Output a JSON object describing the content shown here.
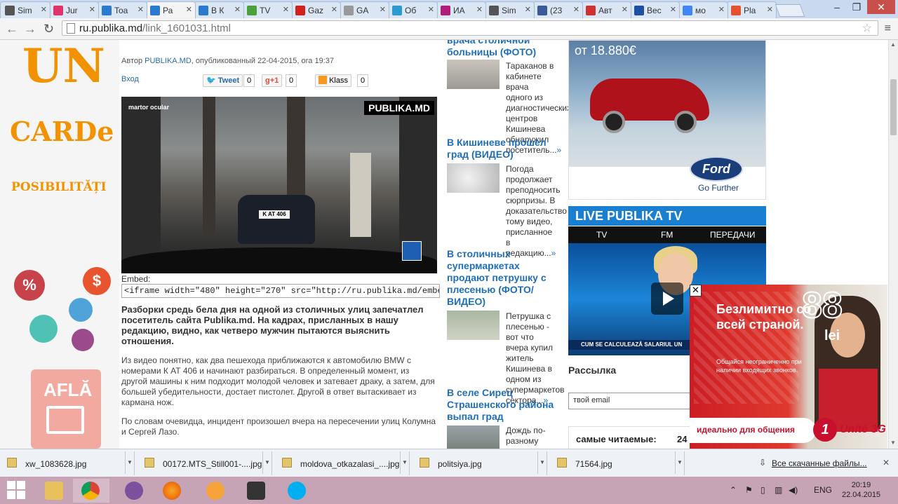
{
  "browser": {
    "tabs": [
      {
        "label": "Sim",
        "icon": "scales-icon",
        "color": "#555555"
      },
      {
        "label": "Jur",
        "icon": "jur-icon",
        "color": "#e0336a"
      },
      {
        "label": "Toa",
        "icon": "page-icon",
        "color": "#2a7ad0"
      },
      {
        "label": "Ра",
        "icon": "page-icon",
        "color": "#2a7ad0",
        "active": true
      },
      {
        "label": "В К",
        "icon": "page-icon",
        "color": "#2a7ad0"
      },
      {
        "label": "TV",
        "icon": "tv7-icon",
        "color": "#4aa03a"
      },
      {
        "label": "Gaz",
        "icon": "flag-icon",
        "color": "#d02020"
      },
      {
        "label": "GA",
        "icon": "doc-icon",
        "color": "#999999"
      },
      {
        "label": "Об",
        "icon": "page-icon",
        "color": "#2a9ad0"
      },
      {
        "label": "ИА",
        "icon": "nit-icon",
        "color": "#b01d7a"
      },
      {
        "label": "Sim",
        "icon": "scales-icon",
        "color": "#555555"
      },
      {
        "label": "(23",
        "icon": "facebook-icon",
        "color": "#3b5998"
      },
      {
        "label": "Авт",
        "icon": "plane-icon",
        "color": "#d03030"
      },
      {
        "label": "Вес",
        "icon": "vesti-icon",
        "color": "#2050a0"
      },
      {
        "label": "мо",
        "icon": "google-icon",
        "color": "#4285f4"
      },
      {
        "label": "Pla",
        "icon": "play-icon",
        "color": "#e5532e"
      }
    ],
    "url_host": "ru.publika.md",
    "url_path": "/link_1601031.html"
  },
  "left_ad": {
    "line1": "UN",
    "line2": "CARDe",
    "line3": "POSIBILITĂȚI",
    "cta": "AFLĂ",
    "bubble_percent": "%",
    "bubble_dollar": "$"
  },
  "article": {
    "meta_prefix": "Автор ",
    "meta_author": "PUBLIKA.MD",
    "meta_suffix": ", опубликованный 22-04-2015, ora 19:37",
    "login": "Вход",
    "share": {
      "tweet": "Tweet",
      "tweet_count": "0",
      "gplus": "g+1",
      "gplus_count": "0",
      "klass": "Klass",
      "klass_count": "0"
    },
    "video": {
      "caption": "martor ocular",
      "brand": "PUBLIKA.MD",
      "plate": "K AT 406"
    },
    "embed_label": "Embed:",
    "embed_code": "<iframe width=\"480\" height=\"270\" src=\"http://ru.publika.md/embed_iframe.php?id=",
    "lead": "Разборки средь бела дня на одной из столичных улиц запечатлел посетитель сайта Publika.md. На кадрах, присланных в нашу редакцию, видно, как четверо мужчин пытаются выяснить отношения.",
    "para1": "Из видео понятно, как два пешехода приближаются к автомобилю BMW с номерами К АТ 406 и начинают разбираться. В определенный момент, из другой машины к ним подходит молодой человек и затевает драку, а затем, для большей убедительности, достает пистолет. Другой в ответ вытаскивает из кармана нож.",
    "para2": "По словам очевидца, инцидент произошел вчера на пересечении улиц Колумна и Сергей Лазо."
  },
  "news": [
    {
      "title": "врача столичной больницы (ФОТО)",
      "text": "Тараканов в кабинете врача одного из диагностических центров Кишинева обнаружил посетитель...",
      "more": "»"
    },
    {
      "title": "В Кишиневе прошел град (ВИДЕО)",
      "text": "Погода продолжает преподносить сюрпризы. В доказательство тому видео, присланное в редакцию...",
      "more": "»"
    },
    {
      "title": "В столичных супермаркетах продают петрушку с плесенью (ФОТО/ВИДЕО)",
      "text": "Петрушка с плесенью - вот что вчера купил житель Кишинева в одном из супермаркетов сектора...",
      "more": "»"
    },
    {
      "title": "В селе Сирец Страшенского района выпал град",
      "text": "Дождь по-разному",
      "more": ""
    }
  ],
  "ford_ad": {
    "price": "от 18.880€",
    "logo": "Ford",
    "tagline": "Go Further"
  },
  "live_tv": {
    "title": "LIVE PUBLIKA TV",
    "tabs": [
      "TV",
      "FM",
      "ПЕРЕДАЧИ"
    ],
    "ticker": "CUM SE CALCULEAZĂ SALARIUL UN"
  },
  "newsletter": {
    "title": "Рассылка",
    "email_value": "твой email"
  },
  "most_read": {
    "label": "самые читаемые:",
    "value": "24"
  },
  "popup_ad": {
    "headline": "Безлимитно со всей страной.",
    "small": "Общайся неограниченно при наличии входящих звонков.",
    "number": "88",
    "currency": "lei",
    "strip": "идеально для общения",
    "brand": "Unité 3G",
    "close": "✕"
  },
  "downloads": {
    "items": [
      "xw_1083628.jpg",
      "00172.MTS_Still001-....jpg",
      "moldova_otkazalasi_....jpg",
      "politsiya.jpg",
      "71564.jpg"
    ],
    "all": "Все скачанные файлы...",
    "close": "✕"
  },
  "taskbar": {
    "lang": "ENG",
    "time": "20:19",
    "date": "22.04.2015"
  }
}
